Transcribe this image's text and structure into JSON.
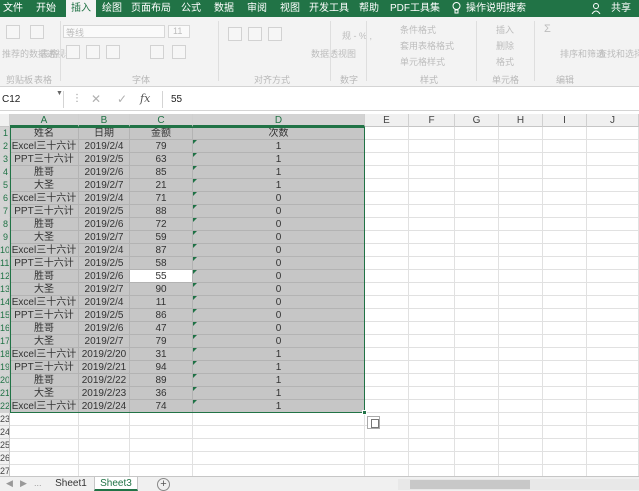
{
  "menu": {
    "tabs": [
      "文件",
      "开始",
      "插入",
      "绘图",
      "页面布局",
      "公式",
      "数据",
      "审阅",
      "视图",
      "开发工具",
      "帮助",
      "PDF工具集",
      "操作说明搜索"
    ],
    "active_index": 2,
    "share": "共享"
  },
  "ribbon": {
    "font_box": "等线",
    "font_size": "11",
    "labels": [
      "规 - % ,",
      "条件格式",
      "套用表格格式",
      "单元格样式",
      "插入",
      "删除",
      "格式",
      "排序和筛选",
      "查找和选择",
      "数据透视图",
      "推荐的数据透视表",
      "表格",
      "Σ"
    ],
    "groups": [
      "剪贴板",
      "表格",
      "字体",
      "对齐方式",
      "数字",
      "样式",
      "单元格",
      "编辑"
    ]
  },
  "formula_bar": {
    "name_box": "C12",
    "value": "55",
    "fx": "fx"
  },
  "grid": {
    "columns": [
      "A",
      "B",
      "C",
      "D",
      "E",
      "F",
      "G",
      "H",
      "I",
      "J"
    ],
    "row_numbers": [
      "1",
      "2",
      "3",
      "4",
      "5",
      "6",
      "7",
      "8",
      "9",
      "10",
      "11",
      "12",
      "13",
      "14",
      "15",
      "16",
      "17",
      "18",
      "19",
      "20",
      "21",
      "22",
      "23",
      "24",
      "25",
      "26",
      "27"
    ],
    "header": [
      "姓名",
      "日期",
      "金额",
      "次数"
    ],
    "rows": [
      [
        "Excel三十六计",
        "2019/2/4",
        "79",
        "1"
      ],
      [
        "PPT三十六计",
        "2019/2/5",
        "63",
        "1"
      ],
      [
        "胜哥",
        "2019/2/6",
        "85",
        "1"
      ],
      [
        "大圣",
        "2019/2/7",
        "21",
        "1"
      ],
      [
        "Excel三十六计",
        "2019/2/4",
        "71",
        "0"
      ],
      [
        "PPT三十六计",
        "2019/2/5",
        "88",
        "0"
      ],
      [
        "胜哥",
        "2019/2/6",
        "72",
        "0"
      ],
      [
        "大圣",
        "2019/2/7",
        "59",
        "0"
      ],
      [
        "Excel三十六计",
        "2019/2/4",
        "87",
        "0"
      ],
      [
        "PPT三十六计",
        "2019/2/5",
        "58",
        "0"
      ],
      [
        "胜哥",
        "2019/2/6",
        "55",
        "0"
      ],
      [
        "大圣",
        "2019/2/7",
        "90",
        "0"
      ],
      [
        "Excel三十六计",
        "2019/2/4",
        "11",
        "0"
      ],
      [
        "PPT三十六计",
        "2019/2/5",
        "86",
        "0"
      ],
      [
        "胜哥",
        "2019/2/6",
        "47",
        "0"
      ],
      [
        "大圣",
        "2019/2/7",
        "79",
        "0"
      ],
      [
        "Excel三十六计",
        "2019/2/20",
        "31",
        "1"
      ],
      [
        "PPT三十六计",
        "2019/2/21",
        "94",
        "1"
      ],
      [
        "胜哥",
        "2019/2/22",
        "89",
        "1"
      ],
      [
        "大圣",
        "2019/2/23",
        "36",
        "1"
      ],
      [
        "Excel三十六计",
        "2019/2/24",
        "74",
        "1"
      ]
    ]
  },
  "sheets": {
    "nav": [
      "◀",
      "▶",
      "..."
    ],
    "tabs": [
      "Sheet1",
      "Sheet3"
    ],
    "active_index": 1,
    "add": "+"
  }
}
